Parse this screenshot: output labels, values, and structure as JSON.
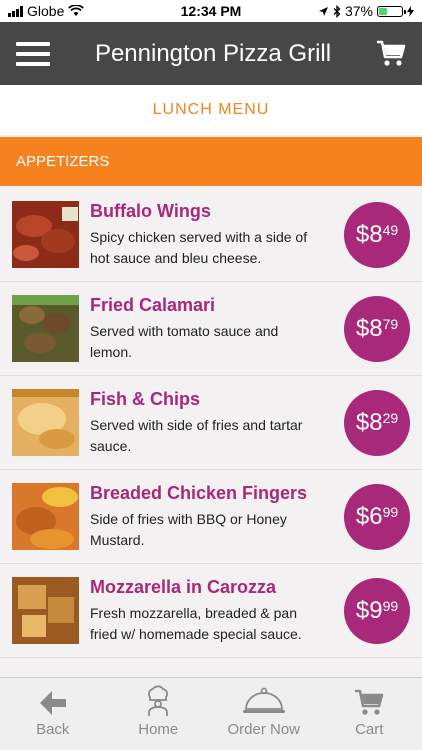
{
  "status_bar": {
    "carrier": "Globe",
    "time": "12:34 PM",
    "battery": "37%",
    "battery_level": 0.37
  },
  "header": {
    "title": "Pennington Pizza Grill",
    "menu_icon": "hamburger-icon",
    "cart_icon": "cart-icon"
  },
  "menu": {
    "label": "LUNCH MENU"
  },
  "category": {
    "name": "APPETIZERS"
  },
  "items": [
    {
      "name": "Buffalo Wings",
      "desc_line1": "Spicy chicken served with a side of",
      "desc_line2": "hot sauce and bleu cheese.",
      "price_dollars": "$8",
      "price_cents": "49",
      "thumb_color": "#8b2b18"
    },
    {
      "name": "Fried Calamari",
      "desc_line1": "Served with tomato sauce and",
      "desc_line2": "lemon.",
      "price_dollars": "$8",
      "price_cents": "79",
      "thumb_color": "#5a5a2c"
    },
    {
      "name": "Fish & Chips",
      "desc_line1": "Served with side of fries and tartar",
      "desc_line2": "sauce.",
      "price_dollars": "$8",
      "price_cents": "29",
      "thumb_color": "#e5b061"
    },
    {
      "name": "Breaded Chicken Fingers",
      "desc_line1": "Side of fries with BBQ or Honey",
      "desc_line2": "Mustard.",
      "price_dollars": "$6",
      "price_cents": "99",
      "thumb_color": "#d9782a"
    },
    {
      "name": "Mozzarella in Carozza",
      "desc_line1": "Fresh mozzarella, breaded & pan",
      "desc_line2": "fried w/ homemade special sauce.",
      "price_dollars": "$9",
      "price_cents": "99",
      "thumb_color": "#9a5a22"
    }
  ],
  "tabs": [
    {
      "label": "Back",
      "icon": "back-arrow-icon"
    },
    {
      "label": "Home",
      "icon": "chef-icon"
    },
    {
      "label": "Order Now",
      "icon": "cloche-icon"
    },
    {
      "label": "Cart",
      "icon": "cart-icon"
    }
  ],
  "colors": {
    "accent_orange": "#f5821f",
    "accent_purple": "#a8287a",
    "header_bg": "#474747"
  }
}
